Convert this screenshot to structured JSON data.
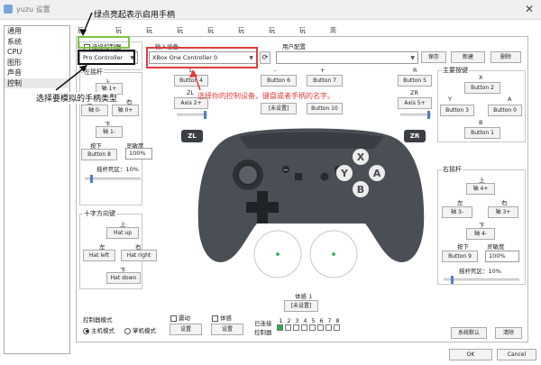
{
  "window": {
    "title": "yuzu 设置",
    "close_glyph": "✕"
  },
  "sidebar": {
    "items": [
      "通用",
      "系统",
      "CPU",
      "图形",
      "声音",
      "控制"
    ],
    "selected": 5
  },
  "tabs": [
    "玩家 1",
    "玩家 2",
    "玩家 3",
    "玩家 4",
    "玩家 5",
    "玩家 6",
    "玩家 7",
    "玩家 8",
    "高阶"
  ],
  "connect": {
    "label": "连接控制器",
    "controller_type": "Pro Controller"
  },
  "input_device": {
    "label": "输入设备",
    "value": "XBox One Controller 0"
  },
  "profile": {
    "label": "用户配置",
    "save": "保存",
    "new": "新建",
    "delete": "删除"
  },
  "annotations": {
    "green_note": "绿点亮起表示启用手柄",
    "type_note": "选择要模拟的手柄类型",
    "device_note": "选择你的控制设备，键盘或者手柄的名字。"
  },
  "left_stick": {
    "title": "左摇杆",
    "up": "上",
    "up_btn": "轴 1+",
    "left": "左",
    "right": "右",
    "left_btn": "轴 0-",
    "right_btn": "轴 0+",
    "down": "下",
    "down_btn": "轴 1-",
    "press": "按下",
    "press_btn": "Button 8",
    "sensitivity": "灵敏度",
    "sensitivity_value": "100%",
    "deadzone": "摇杆死区：10%",
    "deadzone_pct": 10
  },
  "shoulders": {
    "l": "L",
    "l_btn": "Button 4",
    "zl": "ZL",
    "zl_btn": "Axis 2+",
    "minus": "-",
    "minus_btn": "Button 6",
    "plus": "+",
    "plus_btn": "Button 7",
    "home": "主页",
    "home_btn": "[未设置]",
    "capture": "截图",
    "capture_btn": "Button 10",
    "r": "R",
    "r_btn": "Button 5",
    "zr": "ZR",
    "zr_btn": "Axis 5+",
    "zl_badge": "ZL",
    "zr_badge": "ZR"
  },
  "face_buttons": {
    "title": "主要按键",
    "x": "X",
    "x_btn": "Button 2",
    "y": "Y",
    "y_btn": "Button 3",
    "a": "A",
    "a_btn": "Button 0",
    "b": "B",
    "b_btn": "Button 1"
  },
  "dpad": {
    "title": "十字方向键",
    "up": "上",
    "up_btn": "Hat up",
    "left": "左",
    "right": "右",
    "left_btn": "Hat left",
    "right_btn": "Hat right",
    "down": "下",
    "down_btn": "Hat down"
  },
  "right_stick": {
    "title": "右摇杆",
    "up": "上",
    "up_btn": "轴 4+",
    "left": "左",
    "right": "右",
    "left_btn": "轴 3-",
    "right_btn": "轴 3+",
    "down": "下",
    "down_btn": "轴 4-",
    "press": "按下",
    "press_btn": "Button 9",
    "sensitivity": "灵敏度",
    "sensitivity_value": "100%",
    "deadzone": "摇杆死区：10%",
    "deadzone_pct": 10
  },
  "controller_glyphs": {
    "x": "X",
    "y": "Y",
    "a": "A",
    "b": "B",
    "minus": "−",
    "plus": "+"
  },
  "sl_sr": {
    "title": "体感 1",
    "btn": "[未设置]"
  },
  "bottom": {
    "mode_title": "控制器模式",
    "handheld": "主机模式",
    "docked": "掌机模式",
    "vibration": "震动",
    "vibration_btn": "设置",
    "motion": "体感",
    "motion_btn": "设置",
    "connected": "已连接",
    "controller": "控制器",
    "ports": [
      "1",
      "2",
      "3",
      "4",
      "5",
      "6",
      "7",
      "8"
    ],
    "defaults": "系统默认",
    "clear": "清除"
  },
  "dialog": {
    "ok": "OK",
    "cancel": "Cancel"
  },
  "colors": {
    "red": "#e23b3b",
    "green": "#7fc242",
    "controller": "#4a4e55",
    "stick_dot": "#2aa84a"
  }
}
